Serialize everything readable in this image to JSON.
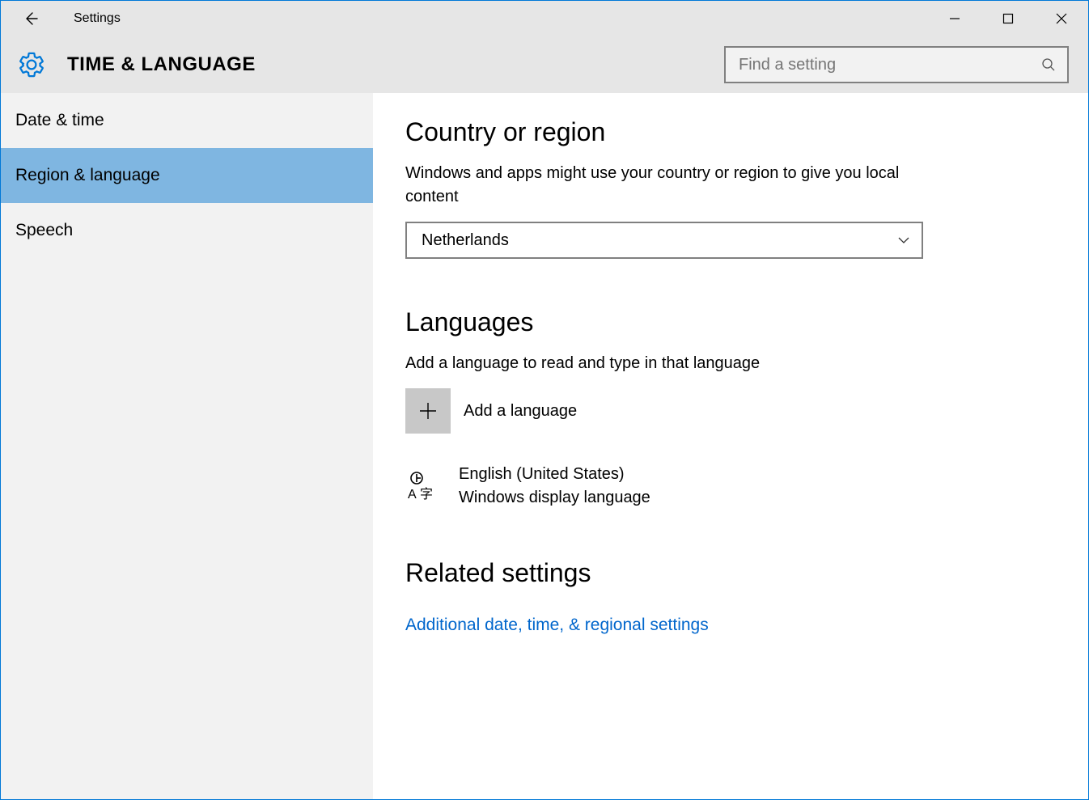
{
  "window": {
    "title": "Settings"
  },
  "header": {
    "page_title": "TIME & LANGUAGE",
    "search_placeholder": "Find a setting"
  },
  "sidebar": {
    "items": [
      {
        "label": "Date & time",
        "selected": false
      },
      {
        "label": "Region & language",
        "selected": true
      },
      {
        "label": "Speech",
        "selected": false
      }
    ]
  },
  "content": {
    "region": {
      "title": "Country or region",
      "description": "Windows and apps might use your country or region to give you local content",
      "selected": "Netherlands"
    },
    "languages": {
      "title": "Languages",
      "description": "Add a language to read and type in that language",
      "add_label": "Add a language",
      "items": [
        {
          "name": "English (United States)",
          "subtitle": "Windows display language"
        }
      ]
    },
    "related": {
      "title": "Related settings",
      "links": [
        {
          "label": "Additional date, time, & regional settings"
        }
      ]
    }
  },
  "colors": {
    "accent": "#0078d7",
    "sidebar_selected": "#7fb6e1",
    "link": "#0066cc"
  }
}
